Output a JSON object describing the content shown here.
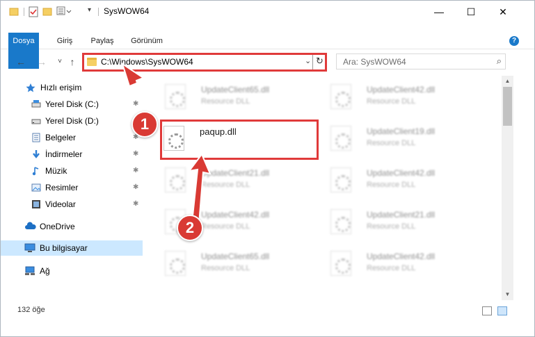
{
  "window": {
    "title": "SysWOW64",
    "minimize": "—",
    "maximize": "☐",
    "close": "✕"
  },
  "ribbon": {
    "tabs": [
      "Dosya",
      "Giriş",
      "Paylaş",
      "Görünüm"
    ],
    "help": "?"
  },
  "nav": {
    "back": "←",
    "forward": "→",
    "recent": "˅",
    "up": "↑",
    "address": "C:\\Windows\\SysWOW64",
    "dropdown": "⌄",
    "refresh": "↻",
    "search_placeholder": "Ara: SysWOW64",
    "search_icon": "⌕"
  },
  "sidebar": {
    "items": [
      {
        "label": "Hızlı erişim",
        "icon": "star-icon"
      },
      {
        "label": "Yerel Disk (C:)",
        "icon": "drive-icon"
      },
      {
        "label": "Yerel Disk (D:)",
        "icon": "drive-icon"
      },
      {
        "label": "Belgeler",
        "icon": "documents-icon"
      },
      {
        "label": "İndirmeler",
        "icon": "download-icon"
      },
      {
        "label": "Müzik",
        "icon": "music-icon"
      },
      {
        "label": "Resimler",
        "icon": "pictures-icon"
      },
      {
        "label": "Videolar",
        "icon": "video-icon"
      },
      {
        "label": "OneDrive",
        "icon": "cloud-icon"
      },
      {
        "label": "Bu bilgisayar",
        "icon": "computer-icon"
      },
      {
        "label": "Ağ",
        "icon": "network-icon"
      }
    ],
    "pin": "📌"
  },
  "files": [
    {
      "name": "UpdateClient65.dll",
      "type": "Resource DLL"
    },
    {
      "name": "UpdateClient42.dll",
      "type": "Resource DLL"
    },
    {
      "name": "paqup.dll",
      "type": ""
    },
    {
      "name": "UpdateClient19.dll",
      "type": "Resource DLL"
    },
    {
      "name": "UpdateClient21.dll",
      "type": "Resource DLL"
    },
    {
      "name": "UpdateClient42.dll",
      "type": "Resource DLL"
    },
    {
      "name": "UpdateClient42.dll",
      "type": "Resource DLL"
    },
    {
      "name": "UpdateClient21.dll",
      "type": "Resource DLL"
    },
    {
      "name": "UpdateClient65.dll",
      "type": "Resource DLL"
    },
    {
      "name": "UpdateClient42.dll",
      "type": "Resource DLL"
    }
  ],
  "status": {
    "count": "132 öğe"
  },
  "callouts": {
    "one": "1",
    "two": "2",
    "color": "#d93a34"
  },
  "colors": {
    "accent": "#1979ca",
    "highlight_border": "#e03a3a",
    "selected": "#cce8ff"
  }
}
